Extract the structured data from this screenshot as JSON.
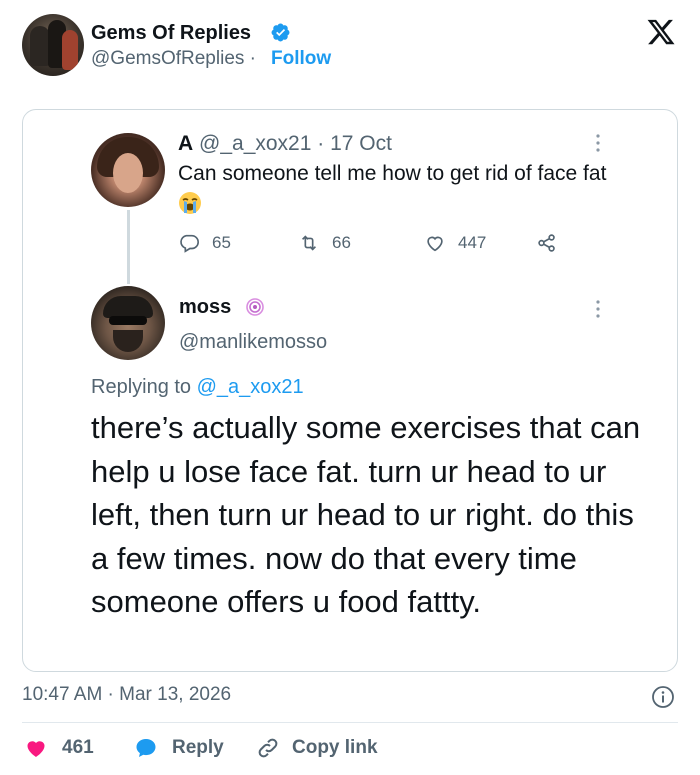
{
  "header": {
    "name": "Gems Of Replies",
    "handle": "@GemsOfReplies",
    "separator": "·",
    "follow_label": "Follow",
    "verified_icon": "verified-badge-icon",
    "logo_icon": "x-logo-icon"
  },
  "quoted_thread": {
    "original": {
      "name": "A",
      "handle": "@_a_xox21",
      "date": "· 17 Oct",
      "text": "Can someone tell me how to get rid of face fat",
      "emoji": "loudly-crying-face-emoji",
      "replies": "65",
      "retweets": "66",
      "likes": "447"
    },
    "reply": {
      "name": "moss",
      "handle": "@manlikemosso",
      "replying_prefix": "Replying to",
      "replying_to": "@_a_xox21",
      "text": "there’s actually some exercises that can help u lose face fat. turn ur head to ur left, then turn ur head to ur right. do this a few times. now do that every time someone offers u food fattty."
    }
  },
  "footer": {
    "timestamp": "10:47 AM · Mar 13, 2026",
    "like_count": "461",
    "reply_label": "Reply",
    "copy_link_label": "Copy link"
  },
  "colors": {
    "accent": "#1d9bf0",
    "text": "#0f1419",
    "muted": "#536471",
    "like": "#f91880",
    "border": "#cfd9de"
  }
}
